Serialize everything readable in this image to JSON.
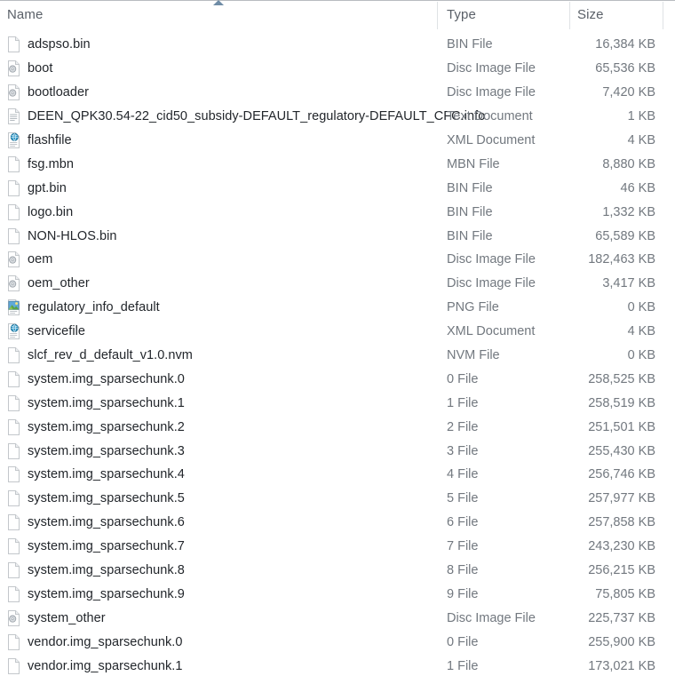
{
  "window": {
    "kind": "file-explorer-details-view"
  },
  "columns": {
    "name": "Name",
    "type": "Type",
    "size": "Size",
    "sort_column": "Name",
    "sort_direction": "ascending"
  },
  "colors": {
    "header_text": "#5a6068",
    "name_text": "#22262b",
    "meta_text": "#72787f",
    "divider": "#dfe2e5",
    "sort_arrow": "#6f8ca6",
    "header_rule": "#b8bcc0"
  },
  "files": [
    {
      "name": "adspso.bin",
      "type": "BIN File",
      "size": "16,384 KB",
      "icon": "generic-file-icon"
    },
    {
      "name": "boot",
      "type": "Disc Image File",
      "size": "65,536 KB",
      "icon": "disc-image-icon"
    },
    {
      "name": "bootloader",
      "type": "Disc Image File",
      "size": "7,420 KB",
      "icon": "disc-image-icon"
    },
    {
      "name": "DEEN_QPK30.54-22_cid50_subsidy-DEFAULT_regulatory-DEFAULT_CFC.info",
      "type": "Text Document",
      "size": "1 KB",
      "icon": "text-document-icon"
    },
    {
      "name": "flashfile",
      "type": "XML Document",
      "size": "4 KB",
      "icon": "xml-document-icon"
    },
    {
      "name": "fsg.mbn",
      "type": "MBN File",
      "size": "8,880 KB",
      "icon": "generic-file-icon"
    },
    {
      "name": "gpt.bin",
      "type": "BIN File",
      "size": "46 KB",
      "icon": "generic-file-icon"
    },
    {
      "name": "logo.bin",
      "type": "BIN File",
      "size": "1,332 KB",
      "icon": "generic-file-icon"
    },
    {
      "name": "NON-HLOS.bin",
      "type": "BIN File",
      "size": "65,589 KB",
      "icon": "generic-file-icon"
    },
    {
      "name": "oem",
      "type": "Disc Image File",
      "size": "182,463 KB",
      "icon": "disc-image-icon"
    },
    {
      "name": "oem_other",
      "type": "Disc Image File",
      "size": "3,417 KB",
      "icon": "disc-image-icon"
    },
    {
      "name": "regulatory_info_default",
      "type": "PNG File",
      "size": "0 KB",
      "icon": "png-image-icon"
    },
    {
      "name": "servicefile",
      "type": "XML Document",
      "size": "4 KB",
      "icon": "xml-document-icon"
    },
    {
      "name": "slcf_rev_d_default_v1.0.nvm",
      "type": "NVM File",
      "size": "0 KB",
      "icon": "generic-file-icon"
    },
    {
      "name": "system.img_sparsechunk.0",
      "type": "0 File",
      "size": "258,525 KB",
      "icon": "generic-file-icon"
    },
    {
      "name": "system.img_sparsechunk.1",
      "type": "1 File",
      "size": "258,519 KB",
      "icon": "generic-file-icon"
    },
    {
      "name": "system.img_sparsechunk.2",
      "type": "2 File",
      "size": "251,501 KB",
      "icon": "generic-file-icon"
    },
    {
      "name": "system.img_sparsechunk.3",
      "type": "3 File",
      "size": "255,430 KB",
      "icon": "generic-file-icon"
    },
    {
      "name": "system.img_sparsechunk.4",
      "type": "4 File",
      "size": "256,746 KB",
      "icon": "generic-file-icon"
    },
    {
      "name": "system.img_sparsechunk.5",
      "type": "5 File",
      "size": "257,977 KB",
      "icon": "generic-file-icon"
    },
    {
      "name": "system.img_sparsechunk.6",
      "type": "6 File",
      "size": "257,858 KB",
      "icon": "generic-file-icon"
    },
    {
      "name": "system.img_sparsechunk.7",
      "type": "7 File",
      "size": "243,230 KB",
      "icon": "generic-file-icon"
    },
    {
      "name": "system.img_sparsechunk.8",
      "type": "8 File",
      "size": "256,215 KB",
      "icon": "generic-file-icon"
    },
    {
      "name": "system.img_sparsechunk.9",
      "type": "9 File",
      "size": "75,805 KB",
      "icon": "generic-file-icon"
    },
    {
      "name": "system_other",
      "type": "Disc Image File",
      "size": "225,737 KB",
      "icon": "disc-image-icon"
    },
    {
      "name": "vendor.img_sparsechunk.0",
      "type": "0 File",
      "size": "255,900 KB",
      "icon": "generic-file-icon"
    },
    {
      "name": "vendor.img_sparsechunk.1",
      "type": "1 File",
      "size": "173,021 KB",
      "icon": "generic-file-icon"
    }
  ]
}
